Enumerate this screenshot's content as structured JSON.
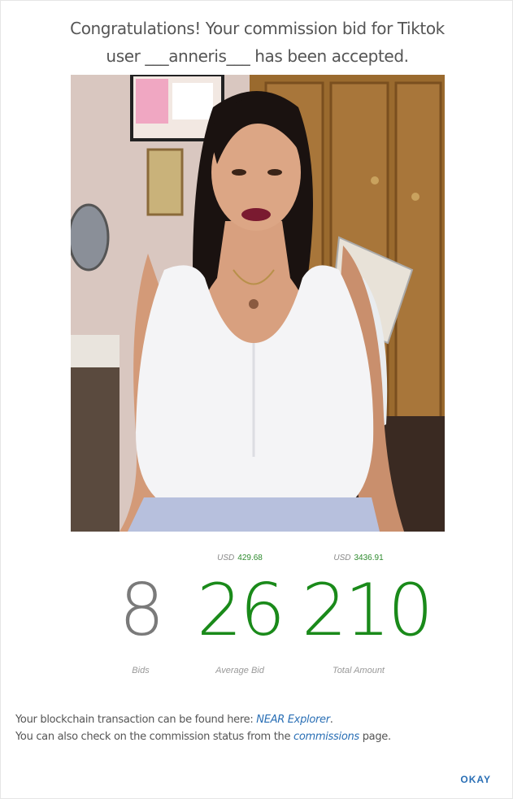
{
  "dialog": {
    "title_line1": "Congratulations! Your commission bid for Tiktok",
    "title_line2": "user ___anneris___ has been accepted."
  },
  "photo": {
    "icon": "profile-photo"
  },
  "stats": {
    "bids": {
      "value": "8",
      "caption": "Bids"
    },
    "average": {
      "currency": "USD",
      "usd_amount": "429.68",
      "value": "26",
      "caption": "Average Bid"
    },
    "total": {
      "currency": "USD",
      "usd_amount": "3436.91",
      "value": "210",
      "caption": "Total Amount"
    }
  },
  "footer": {
    "line1_prefix": "Your blockchain transaction can be found here: ",
    "explorer_link": "NEAR Explorer",
    "line1_suffix": ".",
    "line2_prefix": "You can also check on the commission status from the ",
    "commissions_link": "commissions",
    "line2_suffix": " page."
  },
  "actions": {
    "okay_label": "OKAY"
  },
  "colors": {
    "accent_green": "#1a8a1a",
    "link_blue": "#2a6fb5",
    "number_gray": "#7a7a7a"
  }
}
